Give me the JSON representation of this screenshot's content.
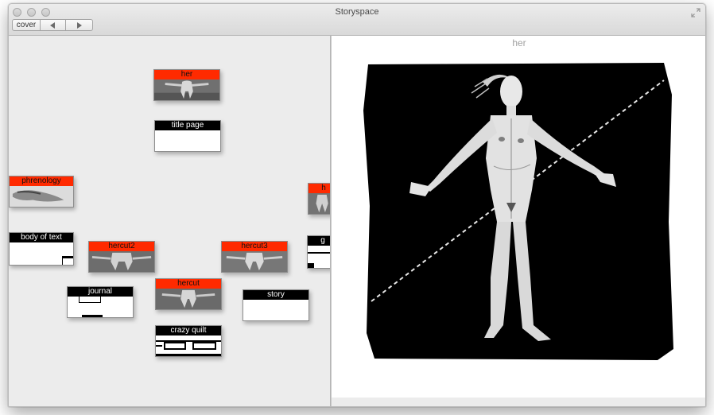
{
  "window": {
    "title": "Storyspace",
    "toolbar": {
      "cover_label": "cover",
      "back_icon": "triangle-left-icon",
      "forward_icon": "triangle-right-icon"
    }
  },
  "map": {
    "notes": [
      {
        "id": "her",
        "label": "her",
        "style": "red-image"
      },
      {
        "id": "title-page",
        "label": "title page",
        "style": "black"
      },
      {
        "id": "phrenology",
        "label": "phrenology",
        "style": "red-image"
      },
      {
        "id": "body-of-text",
        "label": "body of text",
        "style": "black"
      },
      {
        "id": "hercut2",
        "label": "hercut2",
        "style": "red-image"
      },
      {
        "id": "hercut3",
        "label": "hercut3",
        "style": "red-image"
      },
      {
        "id": "hercut",
        "label": "hercut",
        "style": "red-image"
      },
      {
        "id": "journal",
        "label": "journal",
        "style": "black"
      },
      {
        "id": "story",
        "label": "story",
        "style": "black"
      },
      {
        "id": "crazy-quilt",
        "label": "crazy quilt",
        "style": "black"
      },
      {
        "id": "partial-red",
        "label": "h",
        "style": "red-image"
      },
      {
        "id": "partial-black",
        "label": "g",
        "style": "black"
      }
    ]
  },
  "text_pane": {
    "title": "her"
  },
  "colors": {
    "accent_red": "#ff2a00",
    "label_black": "#000000",
    "pane_bg": "#ececec"
  }
}
